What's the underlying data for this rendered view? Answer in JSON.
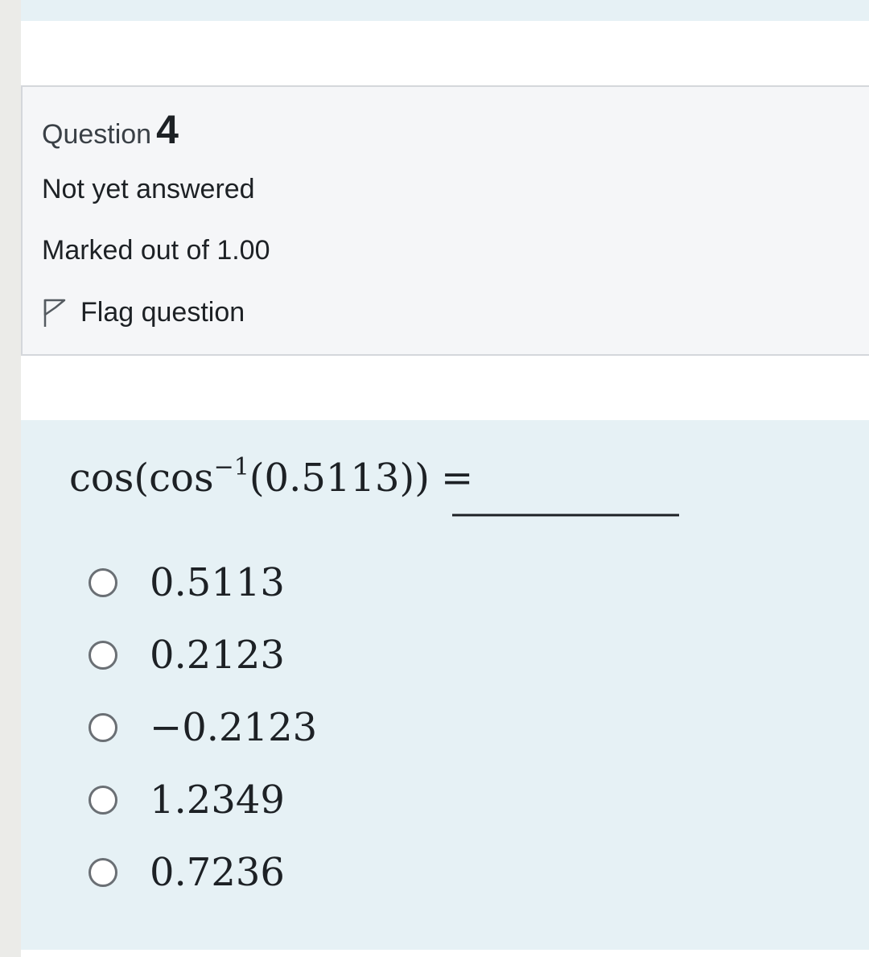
{
  "question": {
    "heading_prefix": "Question",
    "number": "4",
    "state": "Not yet answered",
    "grade": "Marked out of 1.00",
    "flag_label": "Flag question",
    "flag_icon": "flag-outline-icon"
  },
  "formula": {
    "cos1": "cos",
    "paren_open": "(",
    "cos2": "cos",
    "sup": "−1",
    "arg": "(0.5113)",
    "paren_close": ")",
    "equals": "="
  },
  "answers": [
    {
      "label": "0.5113",
      "selected": false
    },
    {
      "label": "0.2123",
      "selected": false
    },
    {
      "label": "−0.2123",
      "selected": false
    },
    {
      "label": "1.2349",
      "selected": false
    },
    {
      "label": "0.7236",
      "selected": false
    }
  ],
  "colors": {
    "info_bg": "#f5f6f8",
    "content_bg": "#e6f1f5",
    "border": "#d4d7db",
    "text": "#1d2125"
  }
}
